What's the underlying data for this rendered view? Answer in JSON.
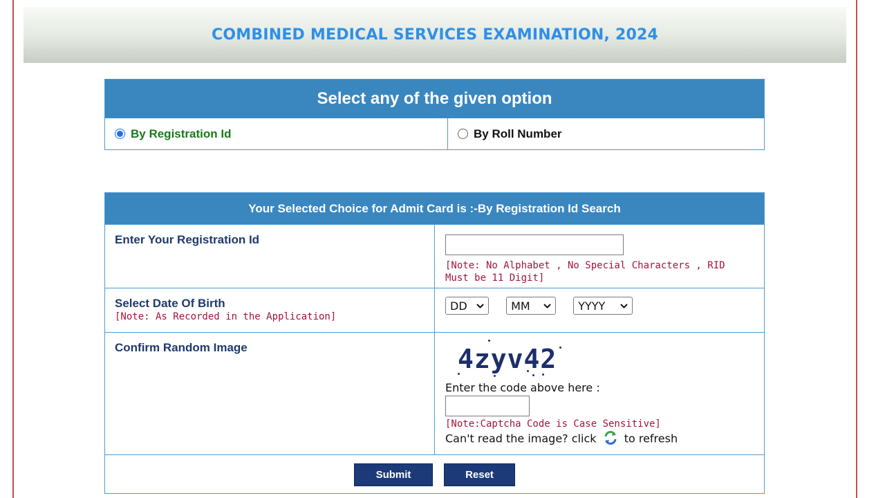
{
  "header": {
    "title": "COMBINED MEDICAL SERVICES EXAMINATION, 2024"
  },
  "options": {
    "heading": "Select any of the given option",
    "by_registration": "By Registration Id",
    "by_roll": "By Roll Number",
    "selected": "By Registration Id"
  },
  "form": {
    "heading": "Your Selected Choice for Admit Card is :-By Registration Id Search",
    "reg_label": "Enter Your Registration Id",
    "reg_value": "",
    "reg_note": "[Note: No Alphabet , No Special Characters , RID Must be 11 Digit]",
    "dob_label": "Select Date Of Birth",
    "dob_note": "[Note: As Recorded in the Application]",
    "dob_dd": "DD",
    "dob_mm": "MM",
    "dob_yyyy": "YYYY",
    "captcha_label": "Confirm Random Image",
    "captcha_code": "4zyv42",
    "captcha_prompt": "Enter the code above here :",
    "captcha_value": "",
    "captcha_note": "[Note:Captcha Code is Case Sensitive]",
    "refresh_prefix": "Can't read the image? click",
    "refresh_suffix": "to refresh",
    "submit_label": "Submit",
    "reset_label": "Reset"
  },
  "colors": {
    "accent": "#3a87c0",
    "title": "#2f8fe8",
    "note": "#a3143c",
    "button": "#1c3a78"
  },
  "icons": {
    "refresh": "refresh-icon"
  }
}
